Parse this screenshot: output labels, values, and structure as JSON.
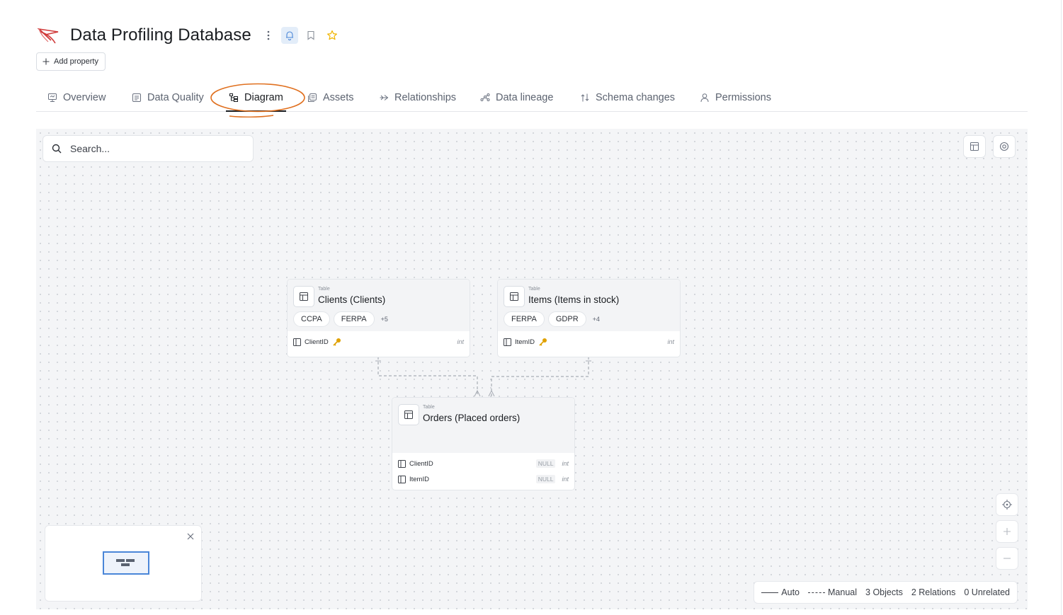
{
  "header": {
    "title": "Data Profiling Database",
    "add_property": "Add property"
  },
  "tabs": [
    {
      "label": "Overview",
      "icon": "overview-icon"
    },
    {
      "label": "Data Quality",
      "icon": "data-quality-icon"
    },
    {
      "label": "Diagram",
      "icon": "diagram-icon",
      "active": true
    },
    {
      "label": "Assets",
      "icon": "assets-icon"
    },
    {
      "label": "Relationships",
      "icon": "relationships-icon"
    },
    {
      "label": "Data lineage",
      "icon": "lineage-icon"
    },
    {
      "label": "Schema changes",
      "icon": "schema-changes-icon"
    },
    {
      "label": "Permissions",
      "icon": "permissions-icon"
    }
  ],
  "search": {
    "placeholder": "Search..."
  },
  "tables": [
    {
      "kind": "Table",
      "name": "Clients (Clients)",
      "tags": [
        "CCPA",
        "FERPA"
      ],
      "more": "+5",
      "columns": [
        {
          "name": "ClientID",
          "key": true,
          "type": "int"
        }
      ]
    },
    {
      "kind": "Table",
      "name": "Items (Items in stock)",
      "tags": [
        "FERPA",
        "GDPR"
      ],
      "more": "+4",
      "columns": [
        {
          "name": "ItemID",
          "key": true,
          "type": "int"
        }
      ]
    },
    {
      "kind": "Table",
      "name": "Orders (Placed orders)",
      "tags": [],
      "columns": [
        {
          "name": "ClientID",
          "null": "NULL",
          "type": "int"
        },
        {
          "name": "ItemID",
          "null": "NULL",
          "type": "int"
        }
      ]
    }
  ],
  "legend": {
    "auto": "Auto",
    "manual": "Manual",
    "objects": "3 Objects",
    "relations": "2 Relations",
    "unrelated": "0 Unrelated"
  },
  "colors": {
    "accent": "#4a86d8",
    "annotation": "#e0701f",
    "key": "#e0a100",
    "star": "#f0b400",
    "logo": "#d03a3a"
  }
}
